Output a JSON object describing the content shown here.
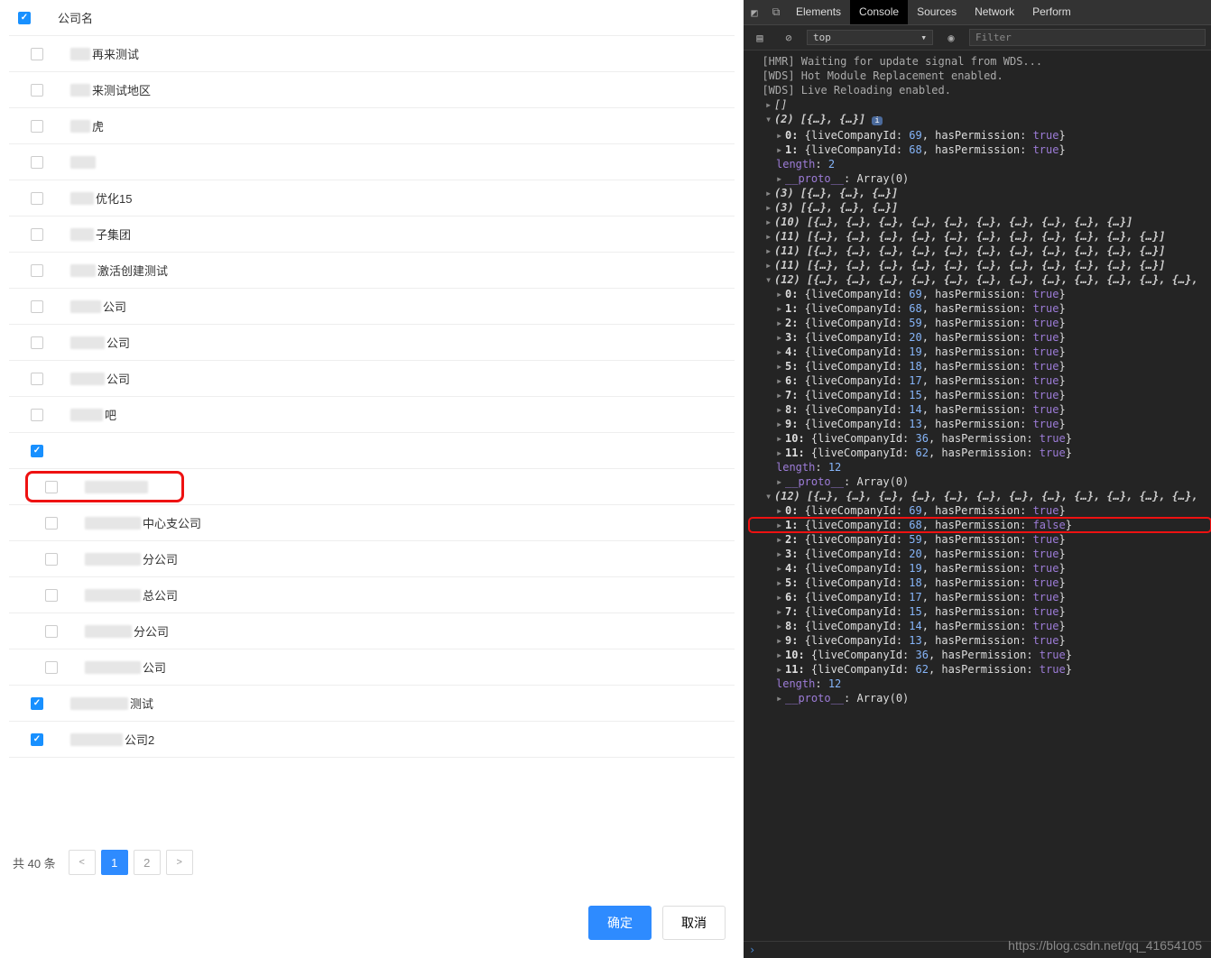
{
  "list": {
    "header": "公司名",
    "items": [
      {
        "label": "再来测试",
        "checked": false,
        "indent": 1,
        "blurW": 22
      },
      {
        "label": "来测试地区",
        "checked": false,
        "indent": 1,
        "blurW": 22
      },
      {
        "label": "虎",
        "checked": false,
        "indent": 1,
        "blurW": 22
      },
      {
        "label": "",
        "checked": false,
        "indent": 1,
        "blurW": 28
      },
      {
        "label": "优化15",
        "checked": false,
        "indent": 1,
        "blurW": 26
      },
      {
        "label": "子集团",
        "checked": false,
        "indent": 1,
        "blurW": 26
      },
      {
        "label": "激活创建测试",
        "checked": false,
        "indent": 1,
        "blurW": 28
      },
      {
        "label": "公司",
        "checked": false,
        "indent": 1,
        "blurW": 34
      },
      {
        "label": "公司",
        "checked": false,
        "indent": 1,
        "blurW": 38
      },
      {
        "label": "公司",
        "checked": false,
        "indent": 1,
        "blurW": 38
      },
      {
        "label": "吧",
        "checked": false,
        "indent": 1,
        "blurW": 36
      },
      {
        "label": "",
        "checked": true,
        "indent": 1,
        "blurW": 0
      },
      {
        "label": "",
        "checked": false,
        "indent": 2,
        "blurW": 70,
        "highlight": true
      },
      {
        "label": "中心支公司",
        "checked": false,
        "indent": 2,
        "blurW": 62
      },
      {
        "label": "分公司",
        "checked": false,
        "indent": 2,
        "blurW": 62
      },
      {
        "label": "总公司",
        "checked": false,
        "indent": 2,
        "blurW": 62
      },
      {
        "label": "分公司",
        "checked": false,
        "indent": 2,
        "blurW": 52
      },
      {
        "label": "公司",
        "checked": false,
        "indent": 2,
        "blurW": 62
      },
      {
        "label": "测试",
        "checked": true,
        "indent": 1,
        "blurW": 64
      },
      {
        "label": "公司2",
        "checked": true,
        "indent": 1,
        "blurW": 58
      }
    ]
  },
  "pagination": {
    "total_label": "共 40 条",
    "pages": [
      "1",
      "2"
    ],
    "current": 1
  },
  "buttons": {
    "ok": "确定",
    "cancel": "取消"
  },
  "devtools": {
    "tabs": [
      "Elements",
      "Console",
      "Sources",
      "Network",
      "Perform"
    ],
    "active_tab": "Console",
    "context": "top",
    "filter_placeholder": "Filter",
    "watermark": "https://blog.csdn.net/qq_41654105",
    "messages": [
      "[HMR] Waiting for update signal from WDS...",
      "[WDS] Hot Module Replacement enabled.",
      "[WDS] Live Reloading enabled."
    ],
    "arrays": {
      "two": {
        "header": "(2) [{…}, {…}]",
        "items": [
          {
            "idx": 0,
            "liveCompanyId": 69,
            "hasPermission": true
          },
          {
            "idx": 1,
            "liveCompanyId": 68,
            "hasPermission": true
          }
        ],
        "length": 2,
        "proto": "__proto__: Array(0)"
      },
      "collapsed": [
        "(3) [{…}, {…}, {…}]",
        "(3) [{…}, {…}, {…}]",
        "(10) [{…}, {…}, {…}, {…}, {…}, {…}, {…}, {…}, {…}, {…}]",
        "(11) [{…}, {…}, {…}, {…}, {…}, {…}, {…}, {…}, {…}, {…}, {…}]",
        "(11) [{…}, {…}, {…}, {…}, {…}, {…}, {…}, {…}, {…}, {…}, {…}]",
        "(11) [{…}, {…}, {…}, {…}, {…}, {…}, {…}, {…}, {…}, {…}, {…}]"
      ],
      "twelve_a": {
        "header": "(12) [{…}, {…}, {…}, {…}, {…}, {…}, {…}, {…}, {…}, {…}, {…}, {…},",
        "items": [
          {
            "idx": 0,
            "liveCompanyId": 69,
            "hasPermission": true
          },
          {
            "idx": 1,
            "liveCompanyId": 68,
            "hasPermission": true
          },
          {
            "idx": 2,
            "liveCompanyId": 59,
            "hasPermission": true
          },
          {
            "idx": 3,
            "liveCompanyId": 20,
            "hasPermission": true
          },
          {
            "idx": 4,
            "liveCompanyId": 19,
            "hasPermission": true
          },
          {
            "idx": 5,
            "liveCompanyId": 18,
            "hasPermission": true
          },
          {
            "idx": 6,
            "liveCompanyId": 17,
            "hasPermission": true
          },
          {
            "idx": 7,
            "liveCompanyId": 15,
            "hasPermission": true
          },
          {
            "idx": 8,
            "liveCompanyId": 14,
            "hasPermission": true
          },
          {
            "idx": 9,
            "liveCompanyId": 13,
            "hasPermission": true
          },
          {
            "idx": 10,
            "liveCompanyId": 36,
            "hasPermission": true
          },
          {
            "idx": 11,
            "liveCompanyId": 62,
            "hasPermission": true
          }
        ],
        "length": 12,
        "proto": "__proto__: Array(0)"
      },
      "twelve_b": {
        "header": "(12) [{…}, {…}, {…}, {…}, {…}, {…}, {…}, {…}, {…}, {…}, {…}, {…},",
        "items": [
          {
            "idx": 0,
            "liveCompanyId": 69,
            "hasPermission": true
          },
          {
            "idx": 1,
            "liveCompanyId": 68,
            "hasPermission": false,
            "highlight": true
          },
          {
            "idx": 2,
            "liveCompanyId": 59,
            "hasPermission": true
          },
          {
            "idx": 3,
            "liveCompanyId": 20,
            "hasPermission": true
          },
          {
            "idx": 4,
            "liveCompanyId": 19,
            "hasPermission": true
          },
          {
            "idx": 5,
            "liveCompanyId": 18,
            "hasPermission": true
          },
          {
            "idx": 6,
            "liveCompanyId": 17,
            "hasPermission": true
          },
          {
            "idx": 7,
            "liveCompanyId": 15,
            "hasPermission": true
          },
          {
            "idx": 8,
            "liveCompanyId": 14,
            "hasPermission": true
          },
          {
            "idx": 9,
            "liveCompanyId": 13,
            "hasPermission": true
          },
          {
            "idx": 10,
            "liveCompanyId": 36,
            "hasPermission": true
          },
          {
            "idx": 11,
            "liveCompanyId": 62,
            "hasPermission": true
          }
        ],
        "length": 12,
        "proto": "__proto__: Array(0)"
      }
    }
  }
}
